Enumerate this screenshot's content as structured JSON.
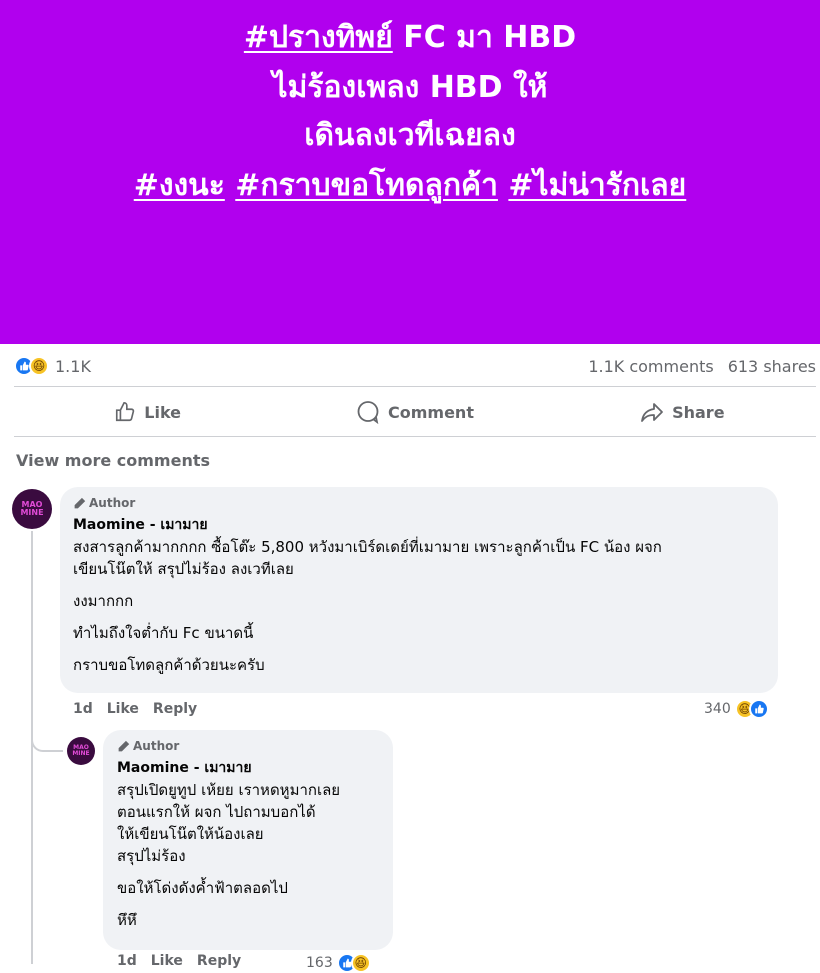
{
  "banner": {
    "line1_tag": "#ปรางทิพย์",
    "line1_rest": " FC มา HBD",
    "line2": "ไม่ร้องเพลง HBD ให้",
    "line3": "เดินลงเวทีเฉยลง",
    "line4_tags": [
      "#งงนะ",
      "#กราบขอโทดลูกค้า",
      "#ไม่น่ารักเลย"
    ],
    "bg_color": "#b100ee"
  },
  "post_stats": {
    "reactions_count": "1.1K",
    "comments": "1.1K comments",
    "shares": "613 shares",
    "reaction_icons": [
      "like-icon",
      "haha-icon"
    ]
  },
  "actions": {
    "like": "Like",
    "comment": "Comment",
    "share": "Share"
  },
  "view_more": "View more comments",
  "comments": [
    {
      "badge": "Author",
      "name": "Maomine - เมามาย",
      "avatar_text": "MAO MINE",
      "lines": [
        "สงสารลูกค้ามากกกก ซื้อโต๊ะ 5,800 หวังมาเบิร์ดเดย์ที่เมามาย เพราะลูกค้าเป็น FC น้อง ผจก",
        "เขียนโน๊ตให้ สรุปไม่ร้อง ลงเวทีเลย",
        "งงมากกก",
        "ทำไมถึงใจต่ำกับ Fc ขนาดนี้",
        "กราบขอโทดลูกค้าด้วยนะครับ"
      ],
      "time": "1d",
      "like": "Like",
      "reply": "Reply",
      "reaction_count": "340"
    },
    {
      "badge": "Author",
      "name": "Maomine - เมามาย",
      "avatar_text": "MAO MINE",
      "lines": [
        "สรุปเปิดยูทูป เห้ยย เราหดหูมากเลย",
        "ตอนแรกให้ ผจก ไปถามบอกได้",
        "ให้เขียนโน๊ตให้น้องเลย",
        "สรุปไม่ร้อง",
        "ขอให้โด่งดังค้ำฟ้าตลอดไป",
        "หึหึ"
      ],
      "time": "1d",
      "like": "Like",
      "reply": "Reply",
      "reaction_count": "163"
    }
  ]
}
